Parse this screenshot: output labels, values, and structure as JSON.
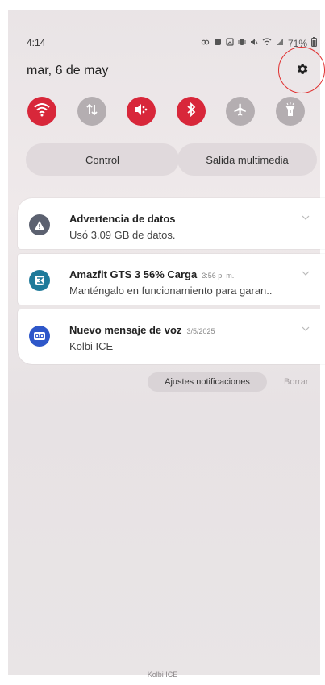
{
  "status_bar": {
    "time": "4:14",
    "battery_text": "71%"
  },
  "date": "mar, 6 de may",
  "quick_settings": {
    "buttons": [
      {
        "icon": "wifi-icon",
        "state": "on"
      },
      {
        "icon": "mobile-data-icon",
        "state": "off"
      },
      {
        "icon": "sound-mute-icon",
        "state": "on"
      },
      {
        "icon": "bluetooth-icon",
        "state": "on"
      },
      {
        "icon": "airplane-icon",
        "state": "off"
      },
      {
        "icon": "flashlight-icon",
        "state": "off"
      }
    ],
    "colors": {
      "on": "#d8273a",
      "off": "#b4aeb1"
    }
  },
  "pills": {
    "control": "Control",
    "media_output": "Salida multimedia"
  },
  "notifications": [
    {
      "title": "Advertencia de datos",
      "time": "",
      "body": "Usó 3.09 GB de datos.",
      "icon": "warning-icon",
      "icon_color": "#5c6170"
    },
    {
      "title": "Amazfit GTS 3 56% Carga",
      "time": "3:56 p. m.",
      "body": "Manténgalo en funcionamiento para garan..",
      "icon": "zepp-icon",
      "icon_color": "#1e7a9a"
    },
    {
      "title": "Nuevo mensaje de voz",
      "time": "3/5/2025",
      "body": "Kolbi ICE",
      "icon": "voicemail-icon",
      "icon_color": "#2e57c9"
    }
  ],
  "actions": {
    "notification_settings": "Ajustes notificaciones",
    "clear": "Borrar"
  },
  "carrier": "Kolbi ICE"
}
